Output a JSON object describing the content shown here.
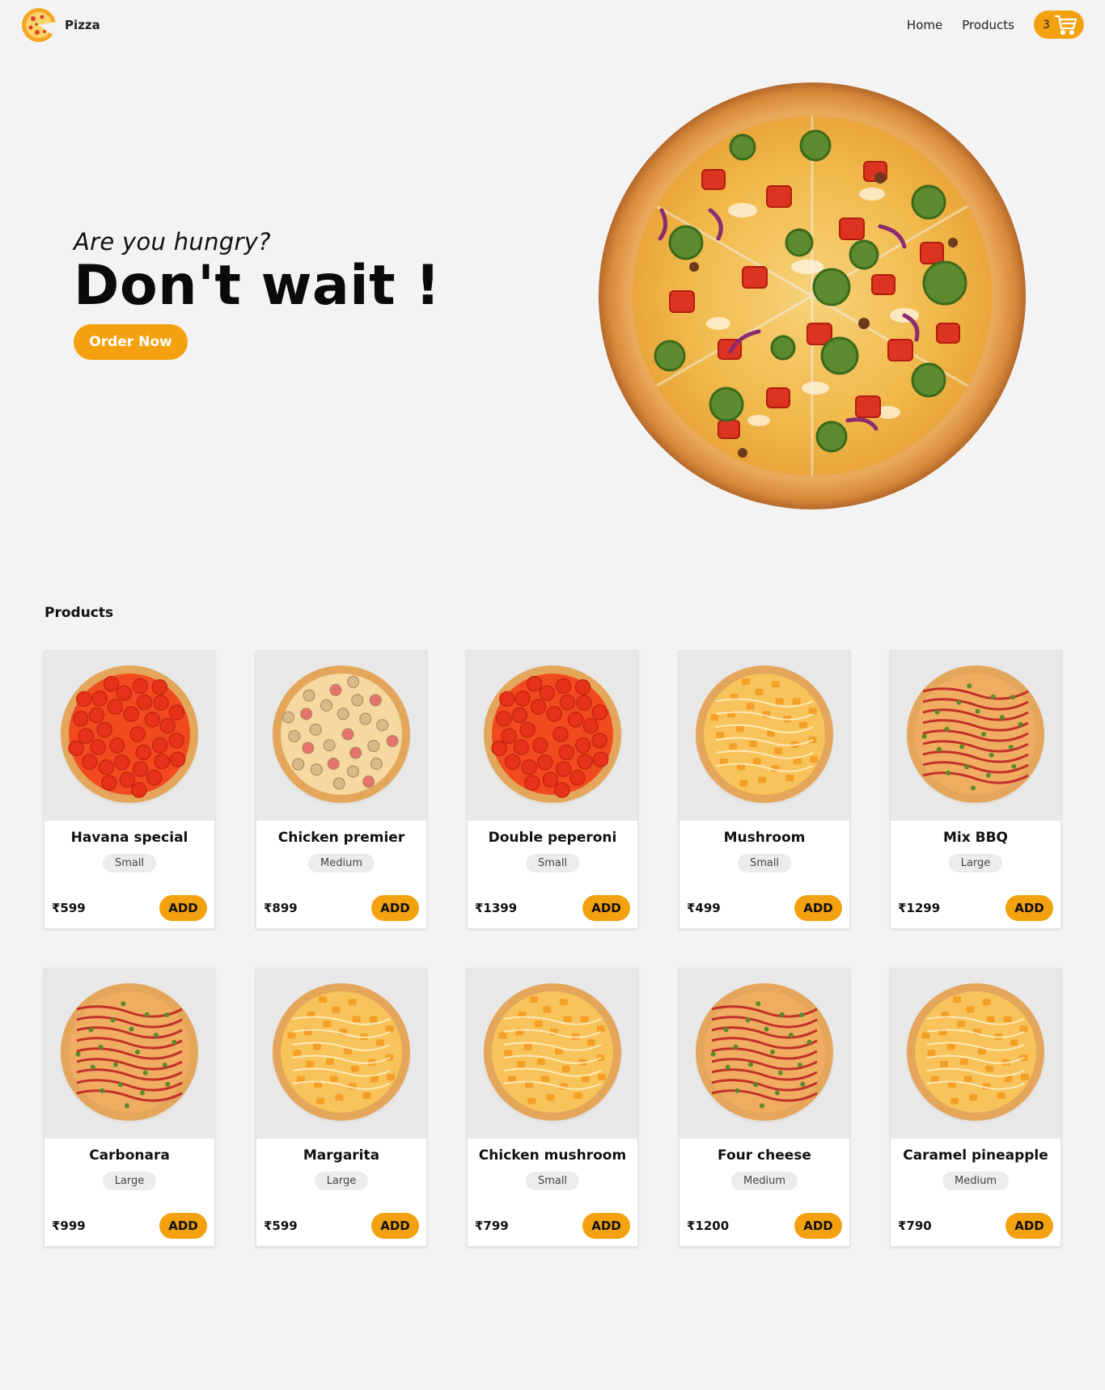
{
  "nav": {
    "brand": "Pizza",
    "links": [
      "Home",
      "Products"
    ],
    "cart_count": "3"
  },
  "hero": {
    "tagline": "Are you hungry?",
    "headline": "Don't wait !",
    "cta": "Order Now"
  },
  "products": {
    "title": "Products",
    "add_label": "ADD",
    "items": [
      {
        "name": "Havana special",
        "size": "Small",
        "price": "₹599",
        "topping": "pepperoni"
      },
      {
        "name": "Chicken premier",
        "size": "Medium",
        "price": "₹899",
        "topping": "mushroom"
      },
      {
        "name": "Double peperoni",
        "size": "Small",
        "price": "₹1399",
        "topping": "pepperoni"
      },
      {
        "name": "Mushroom",
        "size": "Small",
        "price": "₹499",
        "topping": "cheese"
      },
      {
        "name": "Mix BBQ",
        "size": "Large",
        "price": "₹1299",
        "topping": "bbq"
      },
      {
        "name": "Carbonara",
        "size": "Large",
        "price": "₹999",
        "topping": "bbq"
      },
      {
        "name": "Margarita",
        "size": "Large",
        "price": "₹599",
        "topping": "cheese"
      },
      {
        "name": "Chicken mushroom",
        "size": "Small",
        "price": "₹799",
        "topping": "cheese"
      },
      {
        "name": "Four cheese",
        "size": "Medium",
        "price": "₹1200",
        "topping": "bbq"
      },
      {
        "name": "Caramel pineapple",
        "size": "Medium",
        "price": "₹790",
        "topping": "cheese"
      }
    ]
  },
  "colors": {
    "accent": "#f4a10f",
    "background": "#f3f3f3"
  }
}
